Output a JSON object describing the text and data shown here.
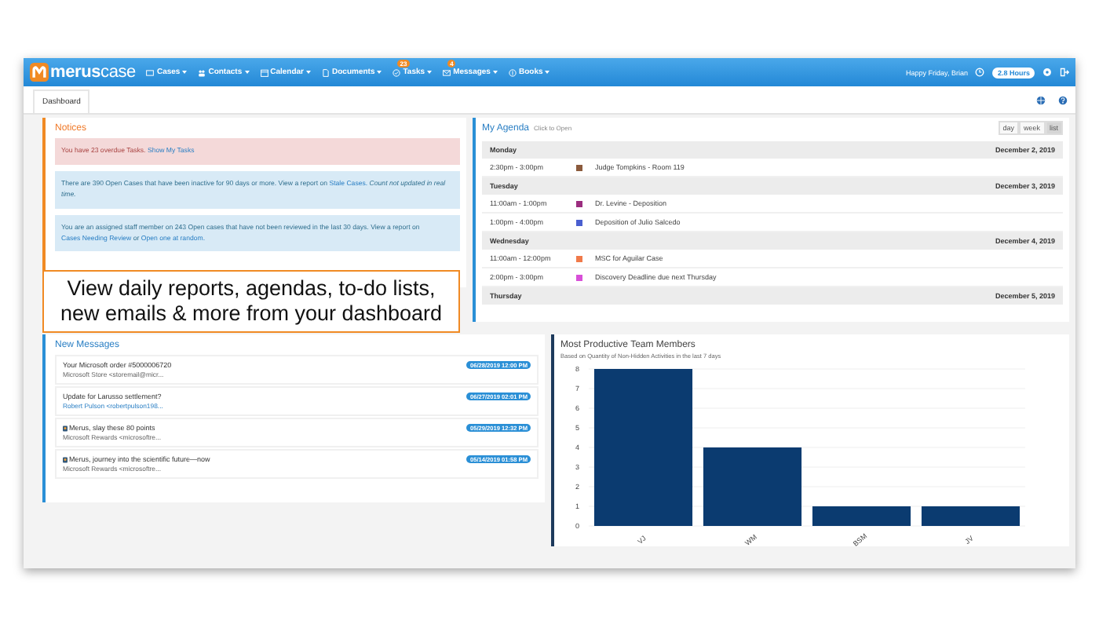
{
  "navbar": {
    "logo_part1": "merus",
    "logo_part2": "case",
    "menu": [
      {
        "label": "Cases"
      },
      {
        "label": "Contacts"
      },
      {
        "label": "Calendar"
      },
      {
        "label": "Documents"
      },
      {
        "label": "Tasks",
        "badge": "23"
      },
      {
        "label": "Messages",
        "badge": "4"
      },
      {
        "label": "Books"
      }
    ],
    "greeting": "Happy Friday, Brian",
    "hours": "2.8 Hours"
  },
  "tabs": [
    {
      "label": "Dashboard",
      "selected": true
    }
  ],
  "notices": {
    "title": "Notices",
    "items": [
      {
        "kind": "danger",
        "segments": [
          {
            "kind": "text",
            "text": "You have 23 overdue Tasks."
          },
          {
            "kind": "link",
            "text": "Show My Tasks"
          }
        ]
      },
      {
        "kind": "info",
        "segments": [
          {
            "kind": "text",
            "text": "There are 390 Open Cases that have been inactive for 90 days or more. View a report on"
          },
          {
            "kind": "link",
            "text": "Stale Cases."
          },
          {
            "kind": "text",
            "text": "*Count not updated in real time.*"
          }
        ]
      },
      {
        "kind": "info",
        "segments": [
          {
            "kind": "text",
            "text": "You are an assigned staff member on 243 Open cases that have not been reviewed in the last 30 days. View a report on"
          },
          {
            "kind": "link",
            "text": "Cases Needing Review"
          },
          {
            "kind": "text",
            "text": "or"
          },
          {
            "kind": "link",
            "text": "Open one at random."
          }
        ]
      }
    ]
  },
  "caption": "View daily reports, agendas, to-do lists, new emails & more from your dashboard",
  "agenda": {
    "title": "My Agenda",
    "hint": "Click to Open",
    "views": [
      {
        "label": "day",
        "selected": false
      },
      {
        "label": "week",
        "selected": false
      },
      {
        "label": "list",
        "selected": true
      }
    ],
    "rows": [
      {
        "kind": "day",
        "day": "Monday",
        "date": "December 2, 2019"
      },
      {
        "kind": "event",
        "time": "2:30pm - 3:00pm",
        "color": "#8b5a3c",
        "title": "Judge Tompkins - Room 119"
      },
      {
        "kind": "day",
        "day": "Tuesday",
        "date": "December 3, 2019"
      },
      {
        "kind": "event",
        "time": "11:00am - 1:00pm",
        "color": "#9b2d7f",
        "title": "Dr. Levine - Deposition"
      },
      {
        "kind": "event",
        "time": "1:00pm - 4:00pm",
        "color": "#4a5fd0",
        "title": "Deposition of Julio Salcedo"
      },
      {
        "kind": "day",
        "day": "Wednesday",
        "date": "December 4, 2019"
      },
      {
        "kind": "event",
        "time": "11:00am - 12:00pm",
        "color": "#f07a4a",
        "title": "MSC for Aguilar Case"
      },
      {
        "kind": "event",
        "time": "2:00pm - 3:00pm",
        "color": "#d84fd8",
        "title": "Discovery Deadline due next Thursday"
      },
      {
        "kind": "day",
        "day": "Thursday",
        "date": "December 5, 2019"
      }
    ]
  },
  "messages": {
    "title": "New Messages",
    "items": [
      {
        "subject": "Your Microsoft order #5000006720",
        "from": "Microsoft Store <storemail@micr...",
        "date": "06/28/2019 12:00 PM",
        "thumbnail": false,
        "from_link": false
      },
      {
        "subject": "Update for Larusso settlement?",
        "from": "Robert Pulson <robertpulson198...",
        "date": "06/27/2019 02:01 PM",
        "thumbnail": false,
        "from_link": true
      },
      {
        "subject": "Merus, slay these 80 points",
        "from": "Microsoft Rewards <microsoftre...",
        "date": "05/29/2019 12:32 PM",
        "thumbnail": true,
        "from_link": false
      },
      {
        "subject": "Merus, journey into the scientific future—now",
        "from": "Microsoft Rewards <microsoftre...",
        "date": "05/14/2019 01:58 PM",
        "thumbnail": true,
        "from_link": false
      }
    ]
  },
  "productive": {
    "title": "Most Productive Team Members",
    "subtitle": "Based on Quantity of Non-Hidden Activities in the last 7 days",
    "chart_data": {
      "type": "bar",
      "categories": [
        "VJ",
        "WM",
        "BSM",
        "JV"
      ],
      "series": [
        {
          "color": "#0b3b70",
          "values": [
            8,
            4,
            1,
            1
          ]
        }
      ],
      "ylim": [
        0,
        8
      ],
      "yticks": [
        0,
        1,
        2,
        3,
        4,
        5,
        6,
        7,
        8
      ],
      "grid": true
    }
  }
}
